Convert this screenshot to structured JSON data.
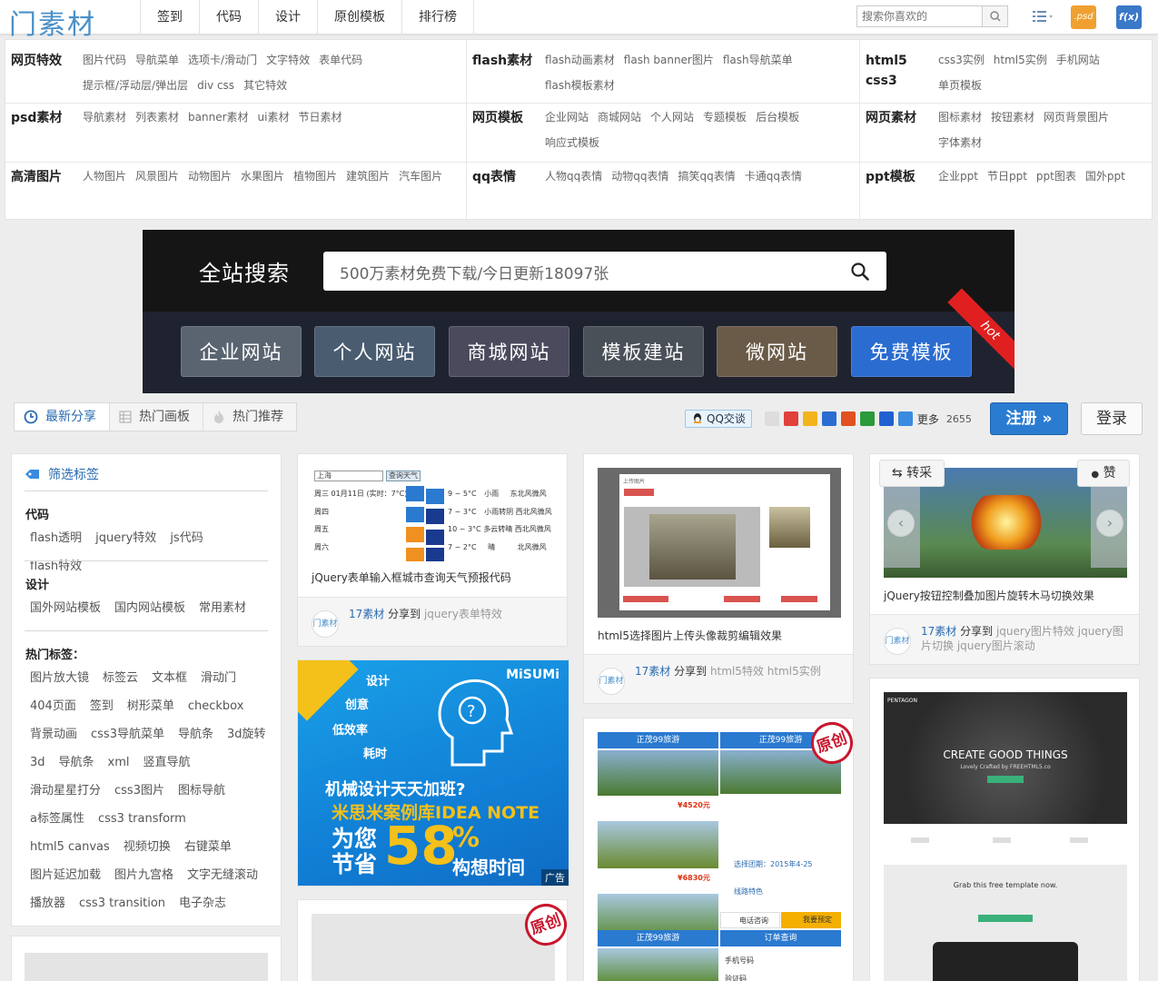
{
  "logo": "门素材",
  "nav": [
    "签到",
    "代码",
    "设计",
    "原创模板",
    "排行榜"
  ],
  "top_search": {
    "placeholder": "搜索你喜欢的"
  },
  "psd_icon_label": ".psd",
  "fx_icon_label": "f(x)",
  "categories": [
    {
      "title": "网页特效",
      "links": [
        "图片代码",
        "导航菜单",
        "选项卡/滑动门",
        "文字特效",
        "表单代码",
        "提示框/浮动层/弹出层",
        "div css",
        "其它特效"
      ]
    },
    {
      "title": "flash素材",
      "links": [
        "flash动画素材",
        "flash banner图片",
        "flash导航菜单",
        "flash模板素材"
      ]
    },
    {
      "title": "html5 css3",
      "links": [
        "css3实例",
        "html5实例",
        "手机网站",
        "单页模板"
      ]
    },
    {
      "title": "psd素材",
      "links": [
        "导航素材",
        "列表素材",
        "banner素材",
        "ui素材",
        "节日素材"
      ]
    },
    {
      "title": "网页模板",
      "links": [
        "企业网站",
        "商城网站",
        "个人网站",
        "专题模板",
        "后台模板",
        "响应式模板"
      ]
    },
    {
      "title": "网页素材",
      "links": [
        "图标素材",
        "按钮素材",
        "网页背景图片",
        "字体素材"
      ]
    },
    {
      "title": "高清图片",
      "links": [
        "人物图片",
        "风景图片",
        "动物图片",
        "水果图片",
        "植物图片",
        "建筑图片",
        "汽车图片"
      ]
    },
    {
      "title": "qq表情",
      "links": [
        "人物qq表情",
        "动物qq表情",
        "搞笑qq表情",
        "卡通qq表情"
      ]
    },
    {
      "title": "ppt模板",
      "links": [
        "企业ppt",
        "节日ppt",
        "ppt图表",
        "国外ppt"
      ]
    }
  ],
  "banner": {
    "search_title": "全站搜索",
    "search_placeholder": "500万素材免费下载/今日更新18097张",
    "tiles": [
      "企业网站",
      "个人网站",
      "商城网站",
      "模板建站",
      "微网站",
      "免费模板"
    ],
    "hot_label": "hot"
  },
  "tabs": [
    "最新分享",
    "热门画板",
    "热门推荐"
  ],
  "share": {
    "qq_label": "QQ交谈",
    "more": "更多",
    "count": "2655"
  },
  "register_label": "注册 »",
  "login_label": "登录",
  "sidebar": {
    "title": "筛选标签",
    "groups": [
      {
        "name": "代码",
        "tags": [
          "flash透明",
          "jquery特效",
          "js代码",
          "flash特效"
        ]
      },
      {
        "name": "设计",
        "tags": [
          "国外网站模板",
          "国内网站模板",
          "常用素材"
        ]
      },
      {
        "name": "热门标签：",
        "tags": [
          "图片放大镜",
          "标签云",
          "文本框",
          "滑动门",
          "404页面",
          "签到",
          "树形菜单",
          "checkbox",
          "背景动画",
          "css3导航菜单",
          "导航条",
          "3d旋转",
          "3d",
          "导航条",
          "xml",
          "竖直导航",
          "滑动星星打分",
          "css3图片",
          "图标导航",
          "a标签属性",
          "css3 transform",
          "html5 canvas",
          "视频切换",
          "右键菜单",
          "图片延迟加载",
          "图片九宫格",
          "文字无缝滚动",
          "播放器",
          "css3 transition",
          "电子杂志"
        ]
      }
    ]
  },
  "cards": {
    "c1": {
      "weather": {
        "city": "上海",
        "button": "查询天气",
        "rows": [
          {
            "day": "周三 01月11日 (实时：7°C)",
            "temp": "9 ~ 5°C",
            "desc": "小雨",
            "wind": "东北风微风"
          },
          {
            "day": "周四",
            "temp": "7 ~ 3°C",
            "desc": "小雨转阴",
            "wind": "西北风微风"
          },
          {
            "day": "周五",
            "temp": "10 ~ 3°C",
            "desc": "多云转晴",
            "wind": "西北风微风"
          },
          {
            "day": "周六",
            "temp": "7 ~ 2°C",
            "desc": "晴",
            "wind": "北风微风"
          }
        ]
      },
      "title": "jQuery表单输入框城市查询天气预报代码",
      "user": "17素材",
      "action": "分享到",
      "tags": "jquery表单特效"
    },
    "c2": {
      "dialog_title": "上传图片",
      "title": "html5选择图片上传头像裁剪编辑效果",
      "user": "17素材",
      "action": "分享到",
      "tags": "html5特效 html5实例"
    },
    "c3": {
      "btn_left": "转采",
      "btn_right": "赞",
      "title": "jQuery按钮控制叠加图片旋转木马切换效果",
      "user": "17素材",
      "action": "分享到",
      "tags": "jquery图片特效 jquery图片切换 jquery图片滚动"
    },
    "c4": {
      "brand": "PENTAGON",
      "headline": "CREATE GOOD THINGS",
      "sub": "Lovely Crafted by FREEHTML5.co",
      "grab": "Grab this free template now."
    },
    "c5": {
      "head": "正茂99旅游",
      "price1": "¥4520元",
      "price2": "¥6830元",
      "date": "选择团期：2015年4-25",
      "route": "线路特色",
      "call": "电话咨询",
      "book": "我要预定",
      "order": "订单查询",
      "phone": "手机号码",
      "code": "验证码"
    },
    "yuanchuang": "原创"
  },
  "ad": {
    "brand": "MiSUMi",
    "words": [
      "设计",
      "创意",
      "低效率",
      "耗时"
    ],
    "question": "机械设计天天加班?",
    "line1": "米思米案例库IDEA NOTE",
    "big1": "为您",
    "big2": "节省",
    "pct": "58",
    "pct_sym": "%",
    "tail": "构想时间",
    "tag": "广告"
  }
}
